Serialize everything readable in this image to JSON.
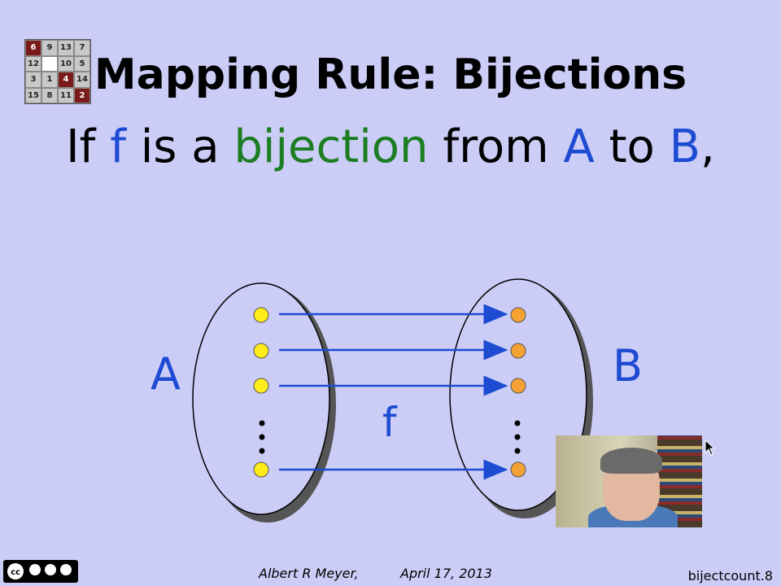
{
  "logo": {
    "cells": [
      "6",
      "9",
      "13",
      "7",
      "12",
      "",
      "10",
      "5",
      "3",
      "1",
      "4",
      "14",
      "15",
      "8",
      "11",
      "2"
    ],
    "red_indices": [
      0,
      10,
      15
    ],
    "blank_index": 5
  },
  "title": "Mapping Rule: Bijections",
  "statement": {
    "part1": "If ",
    "f": "f",
    "part2": " is a ",
    "bijection": "bijection",
    "part3": " from ",
    "A": "A",
    "part4": " to ",
    "B": "B",
    "part5": ","
  },
  "diagram": {
    "set_A_label": "A",
    "set_B_label": "B",
    "function_label": "f",
    "colors": {
      "domain_dot": "#ffec1a",
      "codomain_dot": "#f5a235",
      "arrow": "#1d4bd2",
      "text": "#1d4bd2"
    }
  },
  "footer": {
    "author": "Albert R Meyer,",
    "date": "April 17, 2013",
    "slide_id": "bijectcount.8",
    "license_badge": "cc-by-nc-sa-icon"
  }
}
